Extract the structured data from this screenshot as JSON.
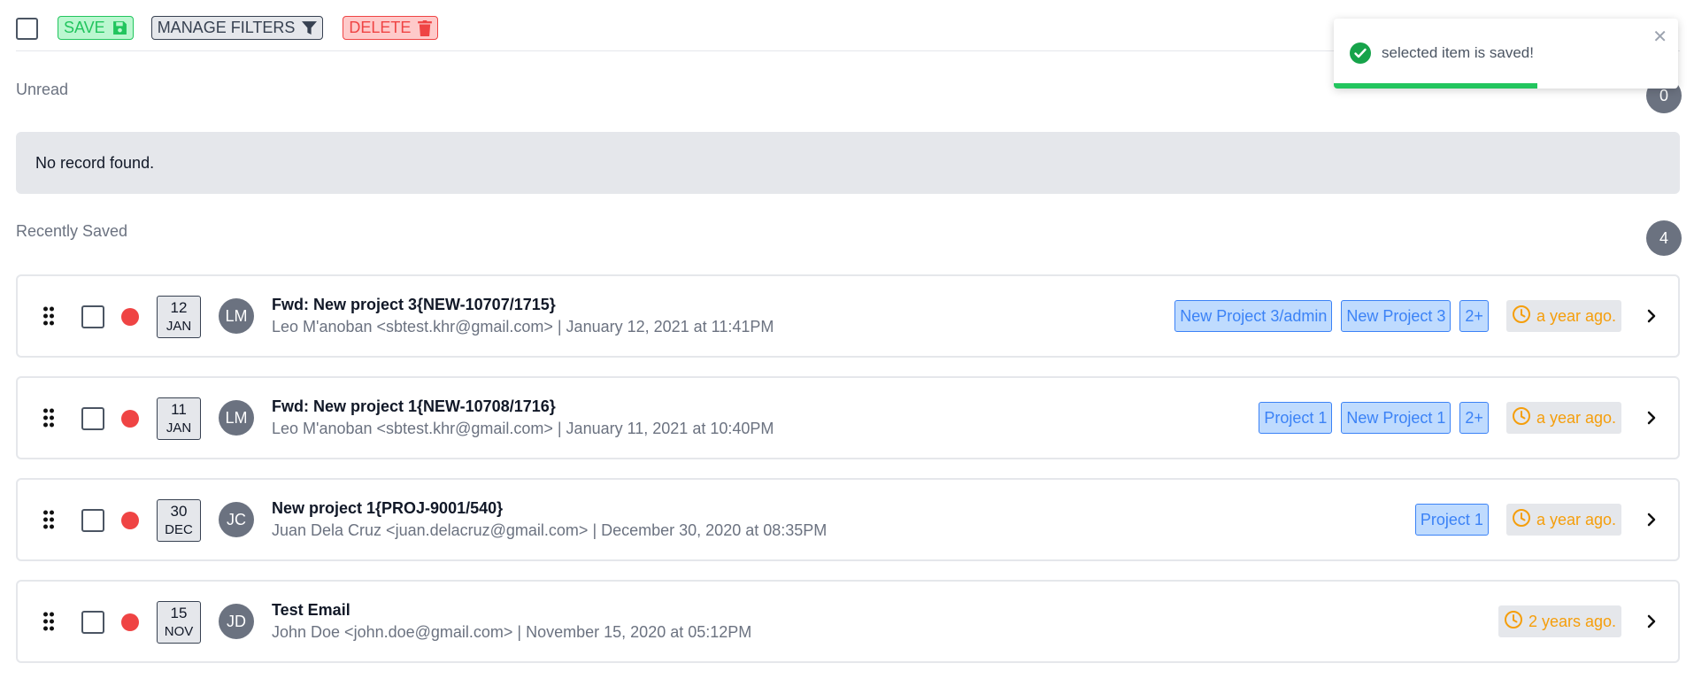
{
  "toolbar": {
    "save_label": "SAVE",
    "manage_filters_label": "MANAGE FILTERS",
    "delete_label": "DELETE"
  },
  "unread": {
    "title": "Unread",
    "count": "0",
    "empty_text": "No record found."
  },
  "recent": {
    "title": "Recently Saved",
    "count": "4",
    "items": [
      {
        "day": "12",
        "month": "JAN",
        "initials": "LM",
        "subject": "Fwd: New project 3{NEW-10707/1715}",
        "meta": "Leo M'anoban <sbtest.khr@gmail.com> | January 12, 2021 at 11:41PM",
        "tags": [
          "New Project 3/admin",
          "New Project 3",
          "2+"
        ],
        "time": "a year ago."
      },
      {
        "day": "11",
        "month": "JAN",
        "initials": "LM",
        "subject": "Fwd: New project 1{NEW-10708/1716}",
        "meta": "Leo M'anoban <sbtest.khr@gmail.com> | January 11, 2021 at 10:40PM",
        "tags": [
          "Project 1",
          "New Project 1",
          "2+"
        ],
        "time": "a year ago."
      },
      {
        "day": "30",
        "month": "DEC",
        "initials": "JC",
        "subject": "New project 1{PROJ-9001/540}",
        "meta": "Juan Dela Cruz <juan.delacruz@gmail.com> | December 30, 2020 at 08:35PM",
        "tags": [
          "Project 1"
        ],
        "time": "a year ago."
      },
      {
        "day": "15",
        "month": "NOV",
        "initials": "JD",
        "subject": "Test Email",
        "meta": "John Doe <john.doe@gmail.com> | November 15, 2020 at 05:12PM",
        "tags": [],
        "time": "2 years ago."
      }
    ]
  },
  "toast": {
    "message": "selected item is saved!",
    "progress": 0.59
  },
  "colors": {
    "success": "#22c55e",
    "danger": "#ef4444",
    "tag_blue": "#3b82f6",
    "time_amber": "#f59e0b",
    "badge_gray": "#6b7280"
  },
  "icons": {
    "save": "floppy-disk-icon",
    "filter": "funnel-icon",
    "delete": "trash-icon",
    "drag": "drag-handle-icon",
    "clock": "clock-icon",
    "chevron": "chevron-right-icon",
    "success": "check-circle-icon",
    "close": "close-icon"
  }
}
